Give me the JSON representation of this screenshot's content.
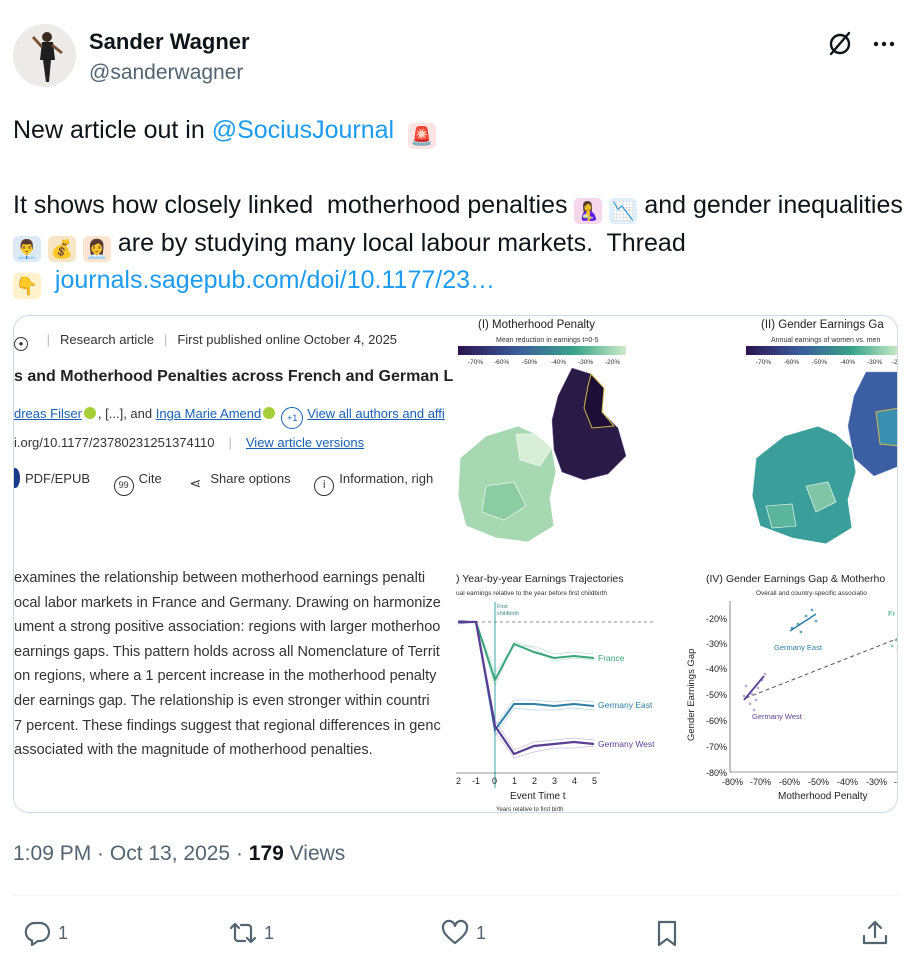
{
  "author": {
    "name": "Sander Wagner",
    "handle": "@sanderwagner"
  },
  "icons": {
    "grok": "grok-icon",
    "more": "more-icon",
    "reply": "reply-icon",
    "retweet": "retweet-icon",
    "like": "heart-icon",
    "bookmark": "bookmark-icon",
    "share": "share-icon"
  },
  "tweet": {
    "intro": "New article out in ",
    "mention": "@SociusJournal",
    "body1": "It shows how closely linked  motherhood penalties ",
    "body2": " and gender inequalities ",
    "body3": " are by studying many local labour markets.  Thread",
    "link": "journals.sagepub.com/doi/10.1177/23…",
    "emojis": {
      "siren": "🚨",
      "mother": "🤱",
      "chart": "📉",
      "worker": "👨‍💼",
      "money": "💰",
      "worker2": "👩‍💼",
      "point": "👇"
    }
  },
  "article": {
    "type": "Research article",
    "published": "First published online October 4, 2025",
    "title": "s and Motherhood Penalties across French and German L",
    "author1": "dreas Filser",
    "ellipsis": ", [...], and ",
    "author2": "Inga Marie Amend",
    "plus_badge": "+1",
    "all_authors": "View all authors and affi",
    "doi": "i.org/10.1177/23780231251374110",
    "versions": "View article versions",
    "tools": [
      "PDF/EPUB",
      "Cite",
      "Share options",
      "Information, righ"
    ],
    "abstract": [
      "examines the relationship between motherhood earnings penalti",
      "ocal labor markets in France and Germany. Drawing on harmonize",
      "ument a strong positive association: regions with larger motherhoo",
      "earnings gaps. This pattern holds across all Nomenclature of Territ",
      "on regions, where a 1 percent increase in the motherhood penalty",
      "der earnings gap. The relationship is even stronger within countri",
      "7 percent. These findings suggest that regional differences in genc",
      " associated with the magnitude of motherhood penalties."
    ]
  },
  "figure": {
    "panel1_title": "(I) Motherhood Penalty",
    "panel1_sub": "Mean reduction in earnings t=0-5",
    "panel1_ticks": [
      "-70%",
      "-60%",
      "-50%",
      "-40%",
      "-30%",
      "-20%"
    ],
    "panel2_title": "(II) Gender Earnings Ga",
    "panel2_sub": "Annual earnings of women vs. men",
    "panel2_ticks": [
      "-70%",
      "-60%",
      "-50%",
      "-40%",
      "-30%",
      "-2"
    ],
    "panel3_title": ") Year-by-year Earnings Trajectories",
    "panel3_sub": "ual earnings relative to the year before first childbirth",
    "first_childbirth_1": "First",
    "first_childbirth_2": "childbirth",
    "panel3_xticks": [
      "2",
      "-1",
      "0",
      "1",
      "2",
      "3",
      "4",
      "5"
    ],
    "panel3_xlabel": "Event Time t",
    "panel3_xsub": "Years relative to first birth",
    "series_france": "France",
    "series_germany_east": "Germany East",
    "series_germany_west": "Germany West",
    "panel4_title": "(IV) Gender Earnings Gap & Motherho",
    "panel4_sub": "Overall and country-specific associatio",
    "panel4_ylabel": "Gender Earnings Gap",
    "panel4_yticks": [
      "-20%",
      "-30%",
      "-40%",
      "-50%",
      "-60%",
      "-70%",
      "-80%"
    ],
    "panel4_xticks": [
      "-80%",
      "-70%",
      "-60%",
      "-50%",
      "-40%",
      "-30%",
      "-2"
    ],
    "panel4_xlabel": "Motherhood Penalty",
    "panel4_label_east": "Germany East",
    "panel4_label_west": "Germany West",
    "panel4_label_fr": "Fr"
  },
  "meta": {
    "time": "1:09 PM · Oct 13, 2025 · ",
    "views_count": "179",
    "views_label": " Views"
  },
  "stats": {
    "replies": "1",
    "reposts": "1",
    "likes": "1"
  },
  "colors": {
    "link": "#1d9bf0",
    "text": "#0f1419",
    "muted": "#536471",
    "france": "#3aa57a",
    "germany_east": "#2e7ea6",
    "germany_west": "#5b3f94"
  }
}
